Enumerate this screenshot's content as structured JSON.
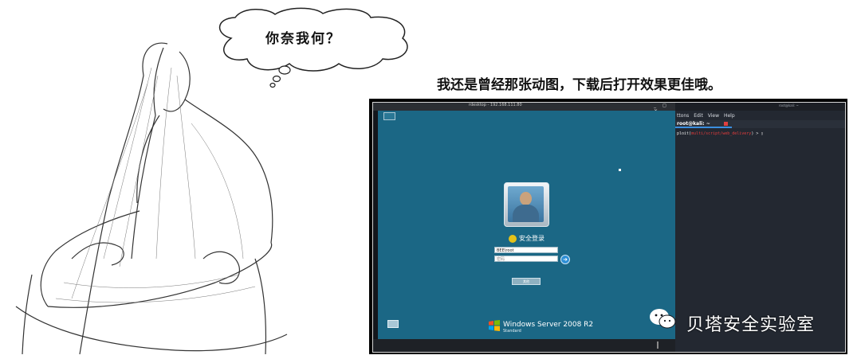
{
  "bubble": {
    "text": "你奈我何？"
  },
  "caption": "我还是曾经那张动图，下载后打开效果更佳哦。",
  "rdp": {
    "title": "rdesktop - 192.168.111.80",
    "controls": "_ ◻ ✕",
    "secure_login": "安全登录",
    "username": "BEE\\root",
    "password_placeholder": "密码",
    "other_button": "其他",
    "os_name": "Windows Server 2008 R2",
    "os_edition": "Standard",
    "colors": {
      "screen": "#1b6785",
      "accent": "#e3c21a"
    }
  },
  "terminal": {
    "window_title": "root@kali: ~",
    "menu": [
      "ttons",
      "Edit",
      "View",
      "Help"
    ],
    "tab_label": "root@kali: ~",
    "prompt_prefix": "ploit(",
    "prompt_module": "multi/script/web_delivery",
    "prompt_suffix": ") > ▯"
  },
  "watermark": {
    "text": "贝塔安全实验室",
    "icon": "wechat-icon"
  }
}
